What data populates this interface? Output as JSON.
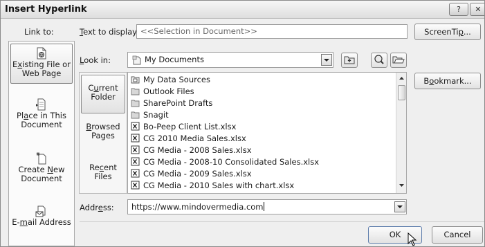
{
  "title": "Insert Hyperlink",
  "titlebar": {
    "help_label": "?",
    "close_label": "✕"
  },
  "link_to_label": "Link to:",
  "text_display": {
    "label_pre": "",
    "label_key": "T",
    "label_post": "ext to display:",
    "value": "<<Selection in Document>>"
  },
  "screentip": {
    "label_pre": "ScreenTi",
    "label_key": "p",
    "label_post": "..."
  },
  "look_in": {
    "label_pre": "",
    "label_key": "L",
    "label_post": "ook in:",
    "value": "My Documents"
  },
  "bookmark": {
    "label_pre": "B",
    "label_key": "o",
    "label_post": "okmark..."
  },
  "link_to_items": [
    {
      "l1_pre": "E",
      "l1_key": "x",
      "l1_post": "isting File or",
      "l2": "Web Page",
      "icon": "document-globe-icon"
    },
    {
      "l1_pre": "Pl",
      "l1_key": "a",
      "l1_post": "ce in This",
      "l2": "Document",
      "icon": "place-in-document-icon"
    },
    {
      "l1_pre": "Create ",
      "l1_key": "N",
      "l1_post": "ew",
      "l2": "Document",
      "icon": "new-document-icon"
    },
    {
      "l1_pre": "E-",
      "l1_key": "m",
      "l1_post": "ail Address",
      "l2": "",
      "icon": "email-icon"
    }
  ],
  "side_items": [
    {
      "l1_pre": "C",
      "l1_key": "u",
      "l1_post": "rrent",
      "l2": "Folder"
    },
    {
      "l1_pre": "",
      "l1_key": "B",
      "l1_post": "rowsed",
      "l2": "Pages"
    },
    {
      "l1_pre": "Re",
      "l1_key": "c",
      "l1_post": "ent",
      "l2": "Files"
    }
  ],
  "files": [
    {
      "name": "My Data Sources",
      "icon": "data-source-folder-icon"
    },
    {
      "name": "Outlook Files",
      "icon": "folder-icon"
    },
    {
      "name": "SharePoint Drafts",
      "icon": "folder-icon"
    },
    {
      "name": "Snagit",
      "icon": "folder-icon"
    },
    {
      "name": "Bo-Peep Client List.xlsx",
      "icon": "excel-file-icon"
    },
    {
      "name": "CG 2010 Media Sales.xlsx",
      "icon": "excel-file-icon"
    },
    {
      "name": "CG Media - 2008 Sales.xlsx",
      "icon": "excel-file-icon"
    },
    {
      "name": "CG Media - 2008-10 Consolidated Sales.xlsx",
      "icon": "excel-file-icon"
    },
    {
      "name": "CG Media - 2009 Sales.xlsx",
      "icon": "excel-file-icon"
    },
    {
      "name": "CG Media - 2010 Sales with chart.xlsx",
      "icon": "excel-file-icon"
    }
  ],
  "address": {
    "label_pre": "Addr",
    "label_key": "e",
    "label_post": "ss:",
    "value": "https://www.mindovermedia.com"
  },
  "ok_label": "OK",
  "cancel_label": "Cancel"
}
